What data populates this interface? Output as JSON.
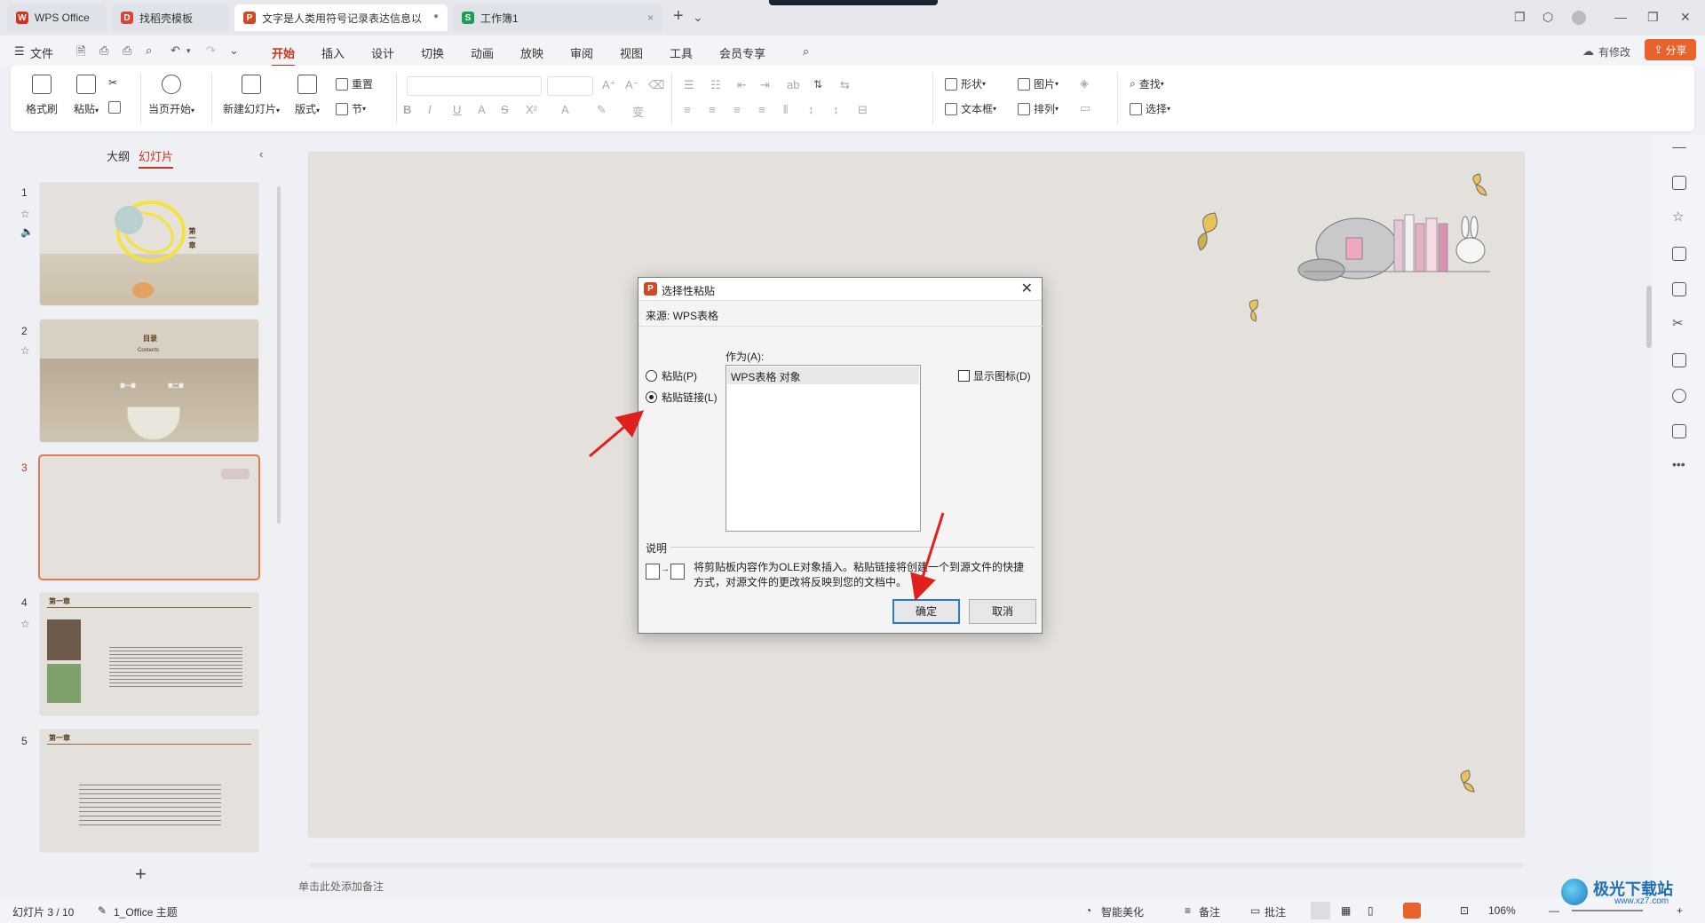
{
  "titlebar": {
    "tabs": [
      {
        "label": "WPS Office",
        "icon": "wps-logo-icon"
      },
      {
        "label": "找稻壳模板",
        "icon": "docer-icon"
      },
      {
        "label": "文字是人类用符号记录表达信息以",
        "icon": "presentation-icon"
      },
      {
        "label": "工作簿1",
        "icon": "spreadsheet-icon"
      }
    ],
    "new_tab": "+"
  },
  "menubar": {
    "file": "文件",
    "items": [
      "开始",
      "插入",
      "设计",
      "切换",
      "动画",
      "放映",
      "审阅",
      "视图",
      "工具",
      "会员专享"
    ],
    "active": "开始",
    "modified": "有修改",
    "share": "分享"
  },
  "ribbon": {
    "format_painter": "格式刷",
    "paste": "粘贴",
    "play_from_current": "当页开始",
    "new_slide": "新建幻灯片",
    "layout": "版式",
    "section": "节",
    "reset": "重置",
    "shape": "形状",
    "picture": "图片",
    "textbox": "文本框",
    "arrange": "排列",
    "find": "查找",
    "select": "选择"
  },
  "leftpanel": {
    "tab_outline": "大纲",
    "tab_slides": "幻灯片",
    "slides": [
      {
        "number": "1",
        "title": "第一章"
      },
      {
        "number": "2",
        "title": "目录",
        "subtitle": "Contents",
        "items": [
          "第一章",
          "第二章"
        ]
      },
      {
        "number": "3"
      },
      {
        "number": "4",
        "title": "第一章"
      },
      {
        "number": "5",
        "title": "第一章"
      }
    ],
    "add_slide": "+"
  },
  "notes_placeholder": "单击此处添加备注",
  "dialog": {
    "title": "选择性粘贴",
    "source": "来源: WPS表格",
    "as_label": "作为(A):",
    "options": [
      "粘贴(P)",
      "粘贴链接(L)"
    ],
    "selected_option": "粘贴链接(L)",
    "list_items": [
      "WPS表格 对象"
    ],
    "show_as_icon": "显示图标(D)",
    "show_as_icon_checked": false,
    "description_label": "说明",
    "description": "将剪贴板内容作为OLE对象插入。粘贴链接将创建一个到源文件的快捷方式，对源文件的更改将反映到您的文档中。",
    "ok": "确定",
    "cancel": "取消"
  },
  "statusbar": {
    "slide_info": "幻灯片 3 / 10",
    "theme": "1_Office 主题",
    "smart_beautify": "智能美化",
    "notes": "备注",
    "comments": "批注",
    "zoom": "106%"
  },
  "watermark": {
    "text": "极光下载站",
    "url": "www.xz7.com"
  },
  "colors": {
    "accent": "#c9331f",
    "share_bg": "#e8632b",
    "slide_bg": "#e4e1dc",
    "selected_border": "#e07b50",
    "primary_button_border": "#2a78d6"
  }
}
